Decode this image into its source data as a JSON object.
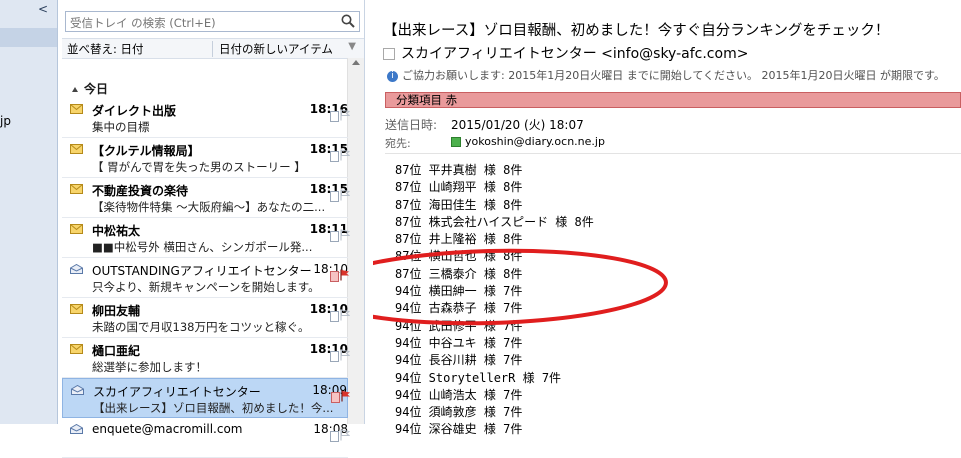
{
  "folder_strip": {
    "collapse_glyph": "<",
    "partial_label": "jp"
  },
  "search": {
    "placeholder": "受信トレイ の検索 (Ctrl+E)"
  },
  "sort": {
    "by": "並べ替え: 日付",
    "order": "日付の新しいアイテム"
  },
  "group": {
    "label": "今日"
  },
  "messages": [
    {
      "sender": "ダイレクト出版",
      "time": "18:16",
      "preview": "集中の目標",
      "unread": true
    },
    {
      "sender": "【クルテル情報局】",
      "time": "18:15",
      "preview": "【  胃がんで胃を失った男のストーリー  】",
      "unread": true
    },
    {
      "sender": "不動産投資の楽待",
      "time": "18:15",
      "preview": "【楽待物件特集 ～大阪府編～】あなたの二...",
      "unread": true
    },
    {
      "sender": "中松祐太",
      "time": "18:11",
      "preview": "■■中松号外  横田さん、シンガポール発...",
      "unread": true
    },
    {
      "sender": "OUTSTANDINGアフィリエイトセンター",
      "time": "18:10",
      "preview": "只今より、新規キャンペーンを開始します。",
      "unread": false,
      "flag": "red"
    },
    {
      "sender": "柳田友輔",
      "time": "18:10",
      "preview": "未踏の国で月収138万円をコツッと稼ぐ。",
      "unread": true
    },
    {
      "sender": "樋口亜紀",
      "time": "18:10",
      "preview": "総選挙に参加します！",
      "unread": true
    },
    {
      "sender": "スカイアフィリエイトセンター",
      "time": "18:09",
      "preview": "【出来レース】ゾロ目報酬、初めました！今...",
      "unread": false,
      "selected": true,
      "flag": "red"
    },
    {
      "sender": "enquete@macromill.com",
      "time": "18:08",
      "preview": "",
      "unread": false
    }
  ],
  "reading": {
    "subject": "【出来レース】ゾロ目報酬、初めました！今すぐ自分ランキングをチェック！",
    "from": "スカイアフィリエイトセンター <info@sky-afc.com>",
    "info": "ご協力お願いします:  2015年1月20日火曜日 までに開始してください。 2015年1月20日火曜日 が期限です。",
    "category": "分類項目 赤",
    "sent_label": "送信日時:",
    "sent_value": "2015/01/20 (火) 18:07",
    "to_label": "宛先:",
    "to_value": "yokoshin@diary.ocn.ne.jp",
    "body_lines": [
      "87位 平井真樹 様 8件",
      "87位 山崎翔平 様 8件",
      "87位 海田佳生 様 8件",
      "87位 株式会社ハイスピード 様 8件",
      "87位 井上隆裕 様 8件",
      "87位 横山哲也 様 8件",
      "87位 三橋泰介 様 8件",
      "94位 横田紳一 様 7件",
      "94位 古森恭子 様 7件",
      "94位 武田修平 様 7件",
      "94位 中谷ユキ 様 7件",
      "94位 長谷川耕 様 7件",
      "94位 StorytellerR 様 7件",
      "94位 山崎浩太 様 7件",
      "94位 須崎敦彦 様 7件",
      "94位 深谷雄史 様 7件"
    ]
  },
  "colors": {
    "selection": "#bcd7f5",
    "category": "#e99a9b",
    "annotation": "#e01e1e",
    "flag": "#d9342b"
  }
}
